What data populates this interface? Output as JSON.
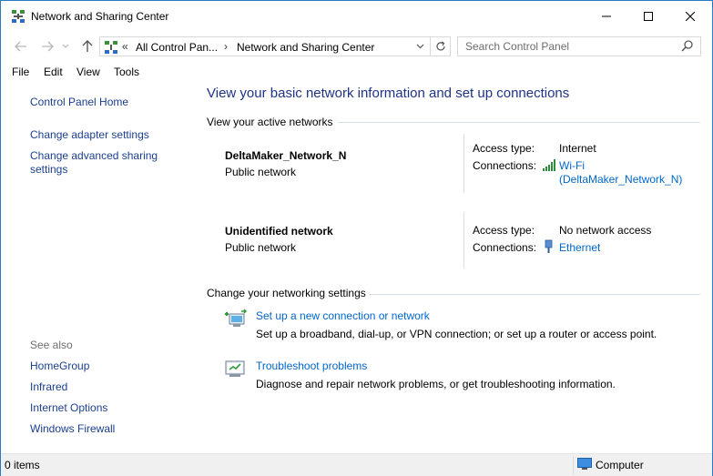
{
  "window": {
    "title": "Network and Sharing Center",
    "controls": {
      "minimize": "minimize",
      "maximize": "maximize",
      "close": "close"
    }
  },
  "nav": {
    "breadcrumb_prefix": "«",
    "breadcrumb": [
      "All Control Pan...",
      "Network and Sharing Center"
    ],
    "breadcrumb_sep": "›",
    "search_placeholder": "Search Control Panel"
  },
  "menu": [
    "File",
    "Edit",
    "View",
    "Tools"
  ],
  "left_pane": {
    "links": [
      "Control Panel Home",
      "Change adapter settings",
      "Change advanced sharing settings"
    ],
    "see_also_heading": "See also",
    "see_also": [
      "HomeGroup",
      "Infrared",
      "Internet Options",
      "Windows Firewall"
    ]
  },
  "main": {
    "title": "View your basic network information and set up connections",
    "active_networks_heading": "View your active networks",
    "networks": [
      {
        "name": "DeltaMaker_Network_N",
        "type": "Public network",
        "access_type_label": "Access type:",
        "access_type": "Internet",
        "connections_label": "Connections:",
        "connection_line1": "Wi-Fi",
        "connection_line2": "(DeltaMaker_Network_N)"
      },
      {
        "name": "Unidentified network",
        "type": "Public network",
        "access_type_label": "Access type:",
        "access_type": "No network access",
        "connections_label": "Connections:",
        "connection_line1": "Ethernet"
      }
    ],
    "settings_heading": "Change your networking settings",
    "tasks": [
      {
        "link": "Set up a new connection or network",
        "desc": "Set up a broadband, dial-up, or VPN connection; or set up a router or access point."
      },
      {
        "link": "Troubleshoot problems",
        "desc": "Diagnose and repair network problems, or get troubleshooting information."
      }
    ]
  },
  "status": {
    "items": "0 items",
    "location": "Computer"
  },
  "colors": {
    "title_blue": "#1e3287",
    "link_blue": "#0066cc",
    "nav_link": "#1a3f8f",
    "border": "#2b79c2"
  }
}
